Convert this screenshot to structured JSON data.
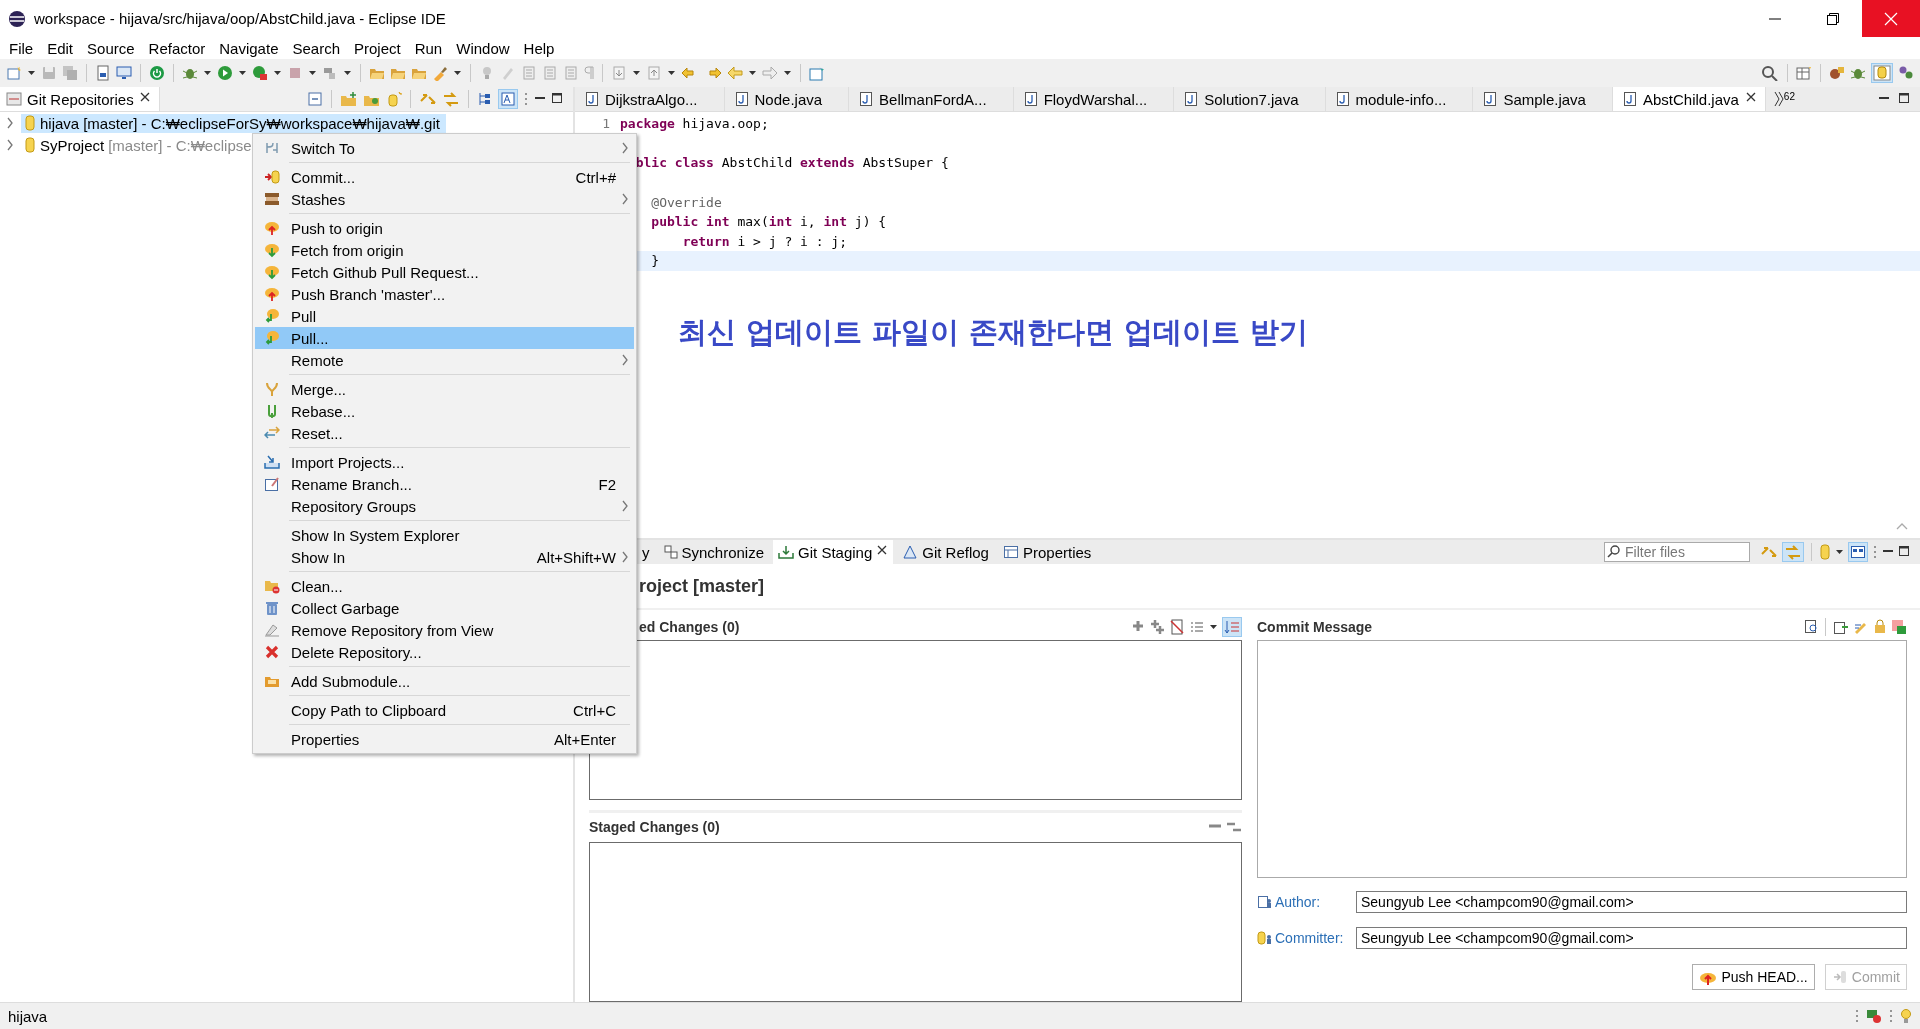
{
  "window": {
    "title": "workspace - hijava/src/hijava/oop/AbstChild.java - Eclipse IDE"
  },
  "menu_bar": [
    "File",
    "Edit",
    "Source",
    "Refactor",
    "Navigate",
    "Search",
    "Project",
    "Run",
    "Window",
    "Help"
  ],
  "git_repositories_view": {
    "title": "Git Repositories",
    "repositories": [
      {
        "name": "hijava",
        "branch": "[master]",
        "path": "- C:₩eclipseForSy₩workspace₩hijava₩.git",
        "selected": true,
        "expanded": false
      },
      {
        "name": "SyProject",
        "branch": "[master]",
        "path": "- C:₩eclipse",
        "selected": false,
        "expanded": false
      }
    ]
  },
  "editor": {
    "tabs": [
      {
        "label": "DijkstraAlgo...",
        "selected": false
      },
      {
        "label": "Node.java",
        "selected": false
      },
      {
        "label": "BellmanFordA...",
        "selected": false
      },
      {
        "label": "FloydWarshal...",
        "selected": false
      },
      {
        "label": "Solution7.java",
        "selected": false
      },
      {
        "label": "module-info...",
        "selected": false
      },
      {
        "label": "Sample.java",
        "selected": false
      },
      {
        "label": "AbstChild.java",
        "selected": true
      }
    ],
    "hidden_tab_count": "62",
    "lines": [
      {
        "number": "1",
        "kind": "code",
        "text": "**package** hijava.oop;",
        "current": false
      },
      {
        "kind": "blank",
        "current": false
      },
      {
        "kind": "code",
        "text": "  **blic** **class** AbstChild **extends** AbstSuper {",
        "current": false
      },
      {
        "kind": "blank",
        "current": false
      },
      {
        "kind": "annotation",
        "text": "    @Override",
        "current": false
      },
      {
        "kind": "code",
        "text": "    **public** **int** max(**int** i, **int** j) {",
        "current": false
      },
      {
        "kind": "code",
        "text": "        **return** i > j ? i : j;",
        "current": false
      },
      {
        "kind": "code",
        "text": "    }",
        "current": true
      }
    ],
    "note": "최신 업데이트 파일이 존재한다면 업데이트 받기"
  },
  "context_menu": {
    "items": [
      {
        "kind": "item",
        "label": "Switch To",
        "submenu": true,
        "selected": false
      },
      {
        "kind": "separator"
      },
      {
        "kind": "item",
        "label": "Commit...",
        "shortcut": "Ctrl+#",
        "submenu": false,
        "selected": false
      },
      {
        "kind": "item",
        "label": "Stashes",
        "submenu": true,
        "selected": false
      },
      {
        "kind": "separator"
      },
      {
        "kind": "item",
        "label": "Push to origin",
        "submenu": false,
        "selected": false
      },
      {
        "kind": "item",
        "label": "Fetch from origin",
        "submenu": false,
        "selected": false
      },
      {
        "kind": "item",
        "label": "Fetch Github Pull Request...",
        "submenu": false,
        "selected": false
      },
      {
        "kind": "item",
        "label": "Push Branch 'master'...",
        "submenu": false,
        "selected": false
      },
      {
        "kind": "item",
        "label": "Pull",
        "submenu": false,
        "selected": false
      },
      {
        "kind": "item",
        "label": "Pull...",
        "submenu": false,
        "selected": true
      },
      {
        "kind": "item",
        "label": "Remote",
        "submenu": true,
        "selected": false
      },
      {
        "kind": "separator"
      },
      {
        "kind": "item",
        "label": "Merge...",
        "submenu": false,
        "selected": false
      },
      {
        "kind": "item",
        "label": "Rebase...",
        "submenu": false,
        "selected": false
      },
      {
        "kind": "item",
        "label": "Reset...",
        "submenu": false,
        "selected": false
      },
      {
        "kind": "separator"
      },
      {
        "kind": "item",
        "label": "Import Projects...",
        "submenu": false,
        "selected": false
      },
      {
        "kind": "item",
        "label": "Rename Branch...",
        "shortcut": "F2",
        "submenu": false,
        "selected": false
      },
      {
        "kind": "item",
        "label": "Repository Groups",
        "submenu": true,
        "selected": false
      },
      {
        "kind": "separator"
      },
      {
        "kind": "item",
        "label": "Show In System Explorer",
        "submenu": false,
        "selected": false
      },
      {
        "kind": "item",
        "label": "Show In",
        "shortcut": "Alt+Shift+W",
        "submenu": true,
        "selected": false
      },
      {
        "kind": "separator"
      },
      {
        "kind": "item",
        "label": "Clean...",
        "submenu": false,
        "selected": false
      },
      {
        "kind": "item",
        "label": "Collect Garbage",
        "submenu": false,
        "selected": false
      },
      {
        "kind": "item",
        "label": "Remove Repository from View",
        "submenu": false,
        "selected": false
      },
      {
        "kind": "item",
        "label": "Delete Repository...",
        "submenu": false,
        "selected": false
      },
      {
        "kind": "separator"
      },
      {
        "kind": "item",
        "label": "Add Submodule...",
        "submenu": false,
        "selected": false
      },
      {
        "kind": "separator"
      },
      {
        "kind": "item",
        "label": "Copy Path to Clipboard",
        "shortcut": "Ctrl+C",
        "submenu": false,
        "selected": false
      },
      {
        "kind": "separator"
      },
      {
        "kind": "item",
        "label": "Properties",
        "shortcut": "Alt+Enter",
        "submenu": false,
        "selected": false
      }
    ]
  },
  "bottom_panel": {
    "tabs": [
      {
        "label": "y",
        "selected": false
      },
      {
        "label": "Synchronize",
        "selected": false
      },
      {
        "label": "Git Staging",
        "selected": true
      },
      {
        "label": "Git Reflog",
        "selected": false
      },
      {
        "label": "Properties",
        "selected": false
      }
    ],
    "filter_placeholder": "Filter files",
    "title": "roject [master]",
    "unstaged_title": "ed Changes (0)",
    "staged_title": "Staged Changes (0)",
    "commit_message_title": "Commit Message",
    "author": {
      "label": "Author:",
      "value": "Seungyub Lee <champcom90@gmail.com>"
    },
    "committer": {
      "label": "Committer:",
      "value": "Seungyub Lee <champcom90@gmail.com>"
    },
    "buttons": [
      {
        "label": "Push HEAD...",
        "disabled": false
      },
      {
        "label": "Commit",
        "disabled": true
      }
    ]
  },
  "status_bar": {
    "text": "hijava"
  }
}
